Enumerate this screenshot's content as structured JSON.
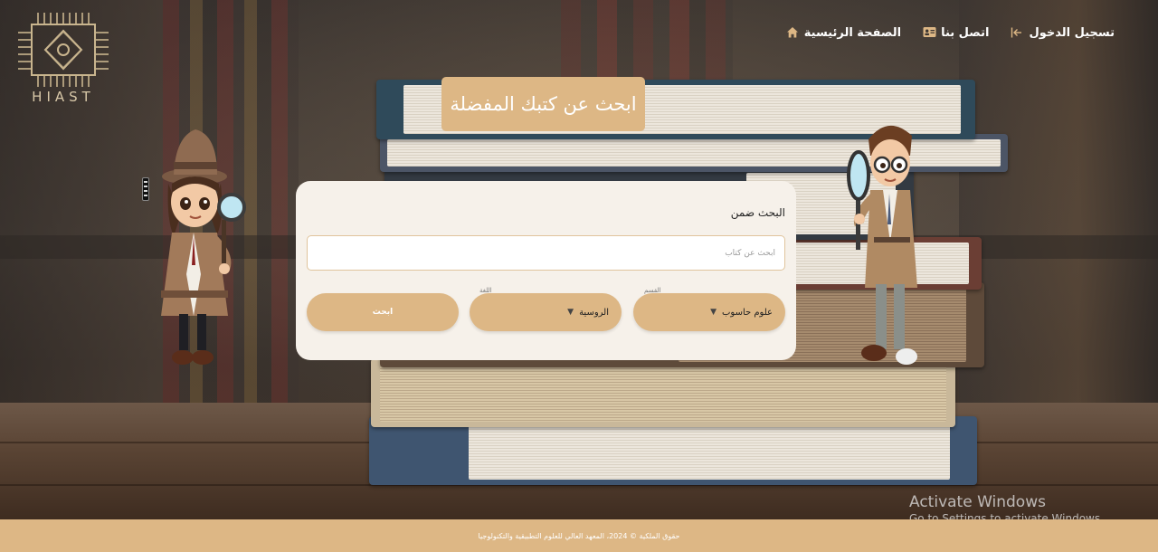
{
  "logo": {
    "text": "HIAST",
    "icon": "hiast-logo-icon"
  },
  "nav": {
    "items": [
      {
        "label": "تسجيل الدخول",
        "icon": "login-icon"
      },
      {
        "label": "اتصل بنا",
        "icon": "contact-card-icon"
      },
      {
        "label": "الصفحة الرئيسية",
        "icon": "home-icon"
      }
    ]
  },
  "heading": "ابحث عن كتبك المفضلة",
  "search": {
    "label": "البحث ضمن",
    "placeholder": "ابحث عن كتاب",
    "value": "",
    "category": {
      "tag": "القسم",
      "selected": "علوم حاسوب"
    },
    "language": {
      "tag": "اللغة",
      "selected": "الروسية"
    },
    "button": "ابحث"
  },
  "footer": "حقوق الملكية © 2024، المعهد العالي للعلوم التطبيقية والتكنولوجيا",
  "windows_watermark": {
    "title": "Activate Windows",
    "subtitle": "Go to Settings to activate Windows."
  },
  "colors": {
    "accent": "#ddb785",
    "card": "#f6f1ea",
    "footer": "#ddb785"
  }
}
